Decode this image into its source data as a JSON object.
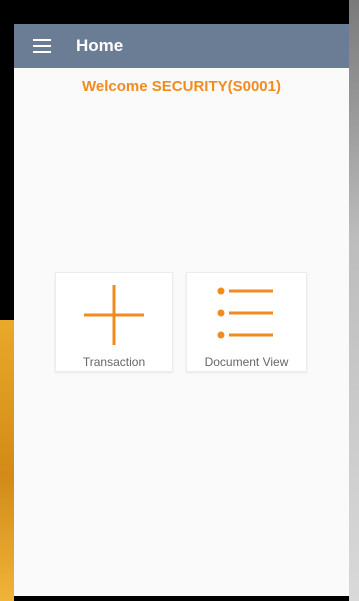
{
  "app_bar": {
    "title": "Home",
    "menu_icon": "hamburger-menu-icon",
    "background_color": "#6b7c95"
  },
  "welcome": {
    "text": "Welcome SECURITY(S0001)",
    "color": "#f28b1f"
  },
  "tiles": [
    {
      "label": "Transaction",
      "icon": "plus-icon"
    },
    {
      "label": "Document View",
      "icon": "list-icon"
    }
  ],
  "accent_color": "#f28b1f"
}
